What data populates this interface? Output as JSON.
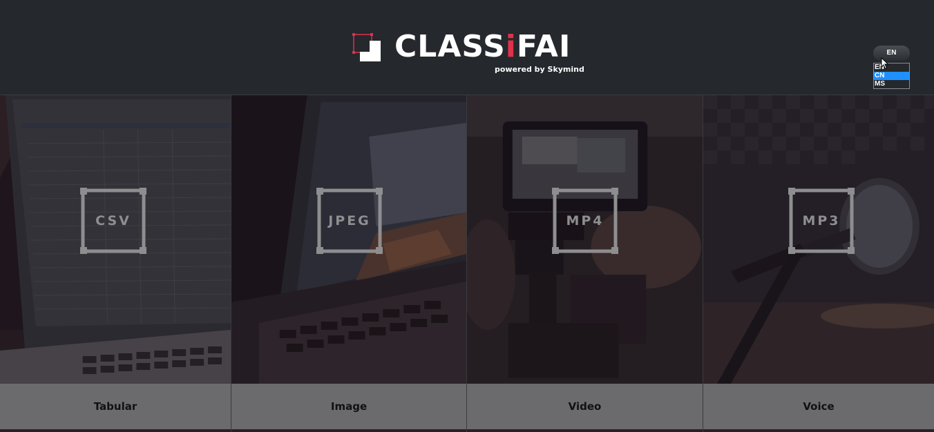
{
  "brand": {
    "name_part1": "CLASS",
    "name_accent": "i",
    "name_part2": "FAI",
    "tagline": "powered by Skymind",
    "accent_color": "#e0314b"
  },
  "language": {
    "current": "EN",
    "options": [
      {
        "label": "EN",
        "selected": false
      },
      {
        "label": "CN",
        "selected": true
      },
      {
        "label": "MS",
        "selected": false
      }
    ]
  },
  "panels": [
    {
      "format": "CSV",
      "caption": "Tabular",
      "icon": "spreadsheet-laptop-photo"
    },
    {
      "format": "JPEG",
      "caption": "Image",
      "icon": "laptop-photo"
    },
    {
      "format": "MP4",
      "caption": "Video",
      "icon": "camera-photo"
    },
    {
      "format": "MP3",
      "caption": "Voice",
      "icon": "microphone-photo"
    }
  ]
}
